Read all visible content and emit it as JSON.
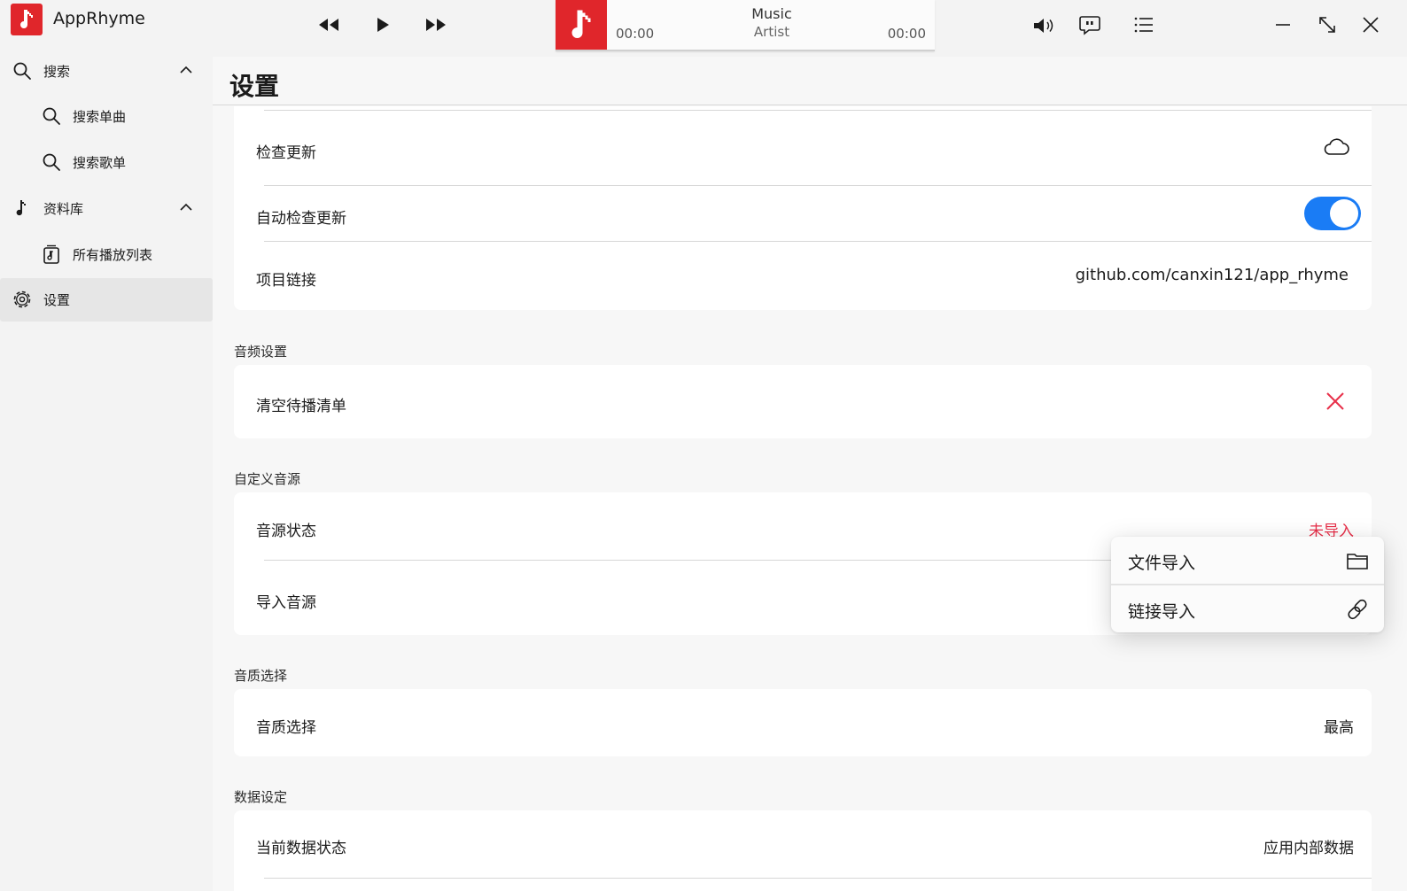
{
  "app": {
    "title": "AppRhyme"
  },
  "sidebar": {
    "items": [
      {
        "label": "搜索",
        "icon": "search-icon",
        "expanded": true
      },
      {
        "label": "搜索单曲",
        "icon": "search-icon"
      },
      {
        "label": "搜索歌单",
        "icon": "search-icon"
      },
      {
        "label": "资料库",
        "icon": "music-note-icon",
        "expanded": true
      },
      {
        "label": "所有播放列表",
        "icon": "playlist-icon"
      },
      {
        "label": "设置",
        "icon": "gear-icon",
        "active": true
      }
    ]
  },
  "player": {
    "track_title": "Music",
    "track_artist": "Artist",
    "time_current": "00:00",
    "time_total": "00:00"
  },
  "page": {
    "title": "设置"
  },
  "settings": {
    "update_card": {
      "check_update": "检查更新",
      "auto_check_update": "自动检查更新",
      "auto_check_enabled": true,
      "project_link_label": "项目链接",
      "project_link_value": "github.com/canxin121/app_rhyme"
    },
    "audio": {
      "section": "音频设置",
      "clear_queue": "清空待播清单"
    },
    "custom_source": {
      "section": "自定义音源",
      "status_label": "音源状态",
      "status_value": "未导入",
      "import_label": "导入音源"
    },
    "quality": {
      "section": "音质选择",
      "label": "音质选择",
      "value": "最高"
    },
    "data": {
      "section": "数据设定",
      "label": "当前数据状态",
      "value": "应用内部数据"
    }
  },
  "flyout": {
    "file_import": "文件导入",
    "link_import": "链接导入"
  },
  "colors": {
    "brand_red": "#e0262b",
    "accent_blue": "#1a7cf5",
    "warning_red": "#e8304a"
  }
}
